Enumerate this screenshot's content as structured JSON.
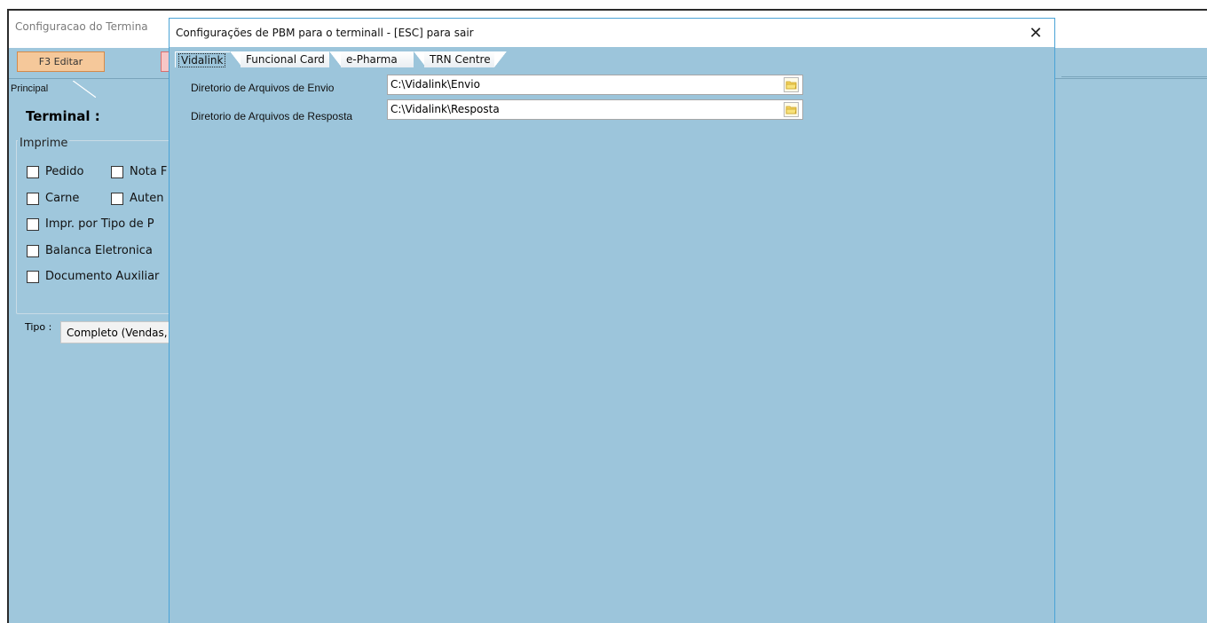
{
  "outer_window": {
    "title": "Configuracao do Termina",
    "edit_button_label": "F3 Editar",
    "tab_principal": "Principal",
    "terminal_label": "Terminal :",
    "imprime_group_title": "Imprime",
    "checkboxes": {
      "pedido": "Pedido",
      "nota": "Nota F",
      "carne": "Carne",
      "autent": "Auten",
      "impr_tipo": "Impr. por Tipo de P",
      "balanca": "Balanca Eletronica",
      "documento": "Documento Auxiliar"
    },
    "tipo_label": "Tipo :",
    "tipo_value": "Completo (Vendas,"
  },
  "dialog": {
    "title": "Configurações de PBM para o terminall - [ESC] para sair",
    "close_symbol": "✕",
    "tabs": [
      "Vidalink",
      "Funcional Card",
      "e-Pharma",
      "TRN Centre"
    ],
    "active_tab": "Vidalink",
    "fields": {
      "envio_label": "Diretorio de Arquivos de Envio",
      "envio_value": "C:\\Vidalink\\Envio",
      "resposta_label": "Diretorio de Arquivos de Resposta",
      "resposta_value": "C:\\Vidalink\\Resposta"
    }
  },
  "colors": {
    "panel_blue": "#9cc5db",
    "edit_button": "#f5c89a",
    "dialog_border": "#4aa3d6"
  },
  "icons": [
    "folder-icon",
    "close-icon",
    "checkbox-icon"
  ]
}
